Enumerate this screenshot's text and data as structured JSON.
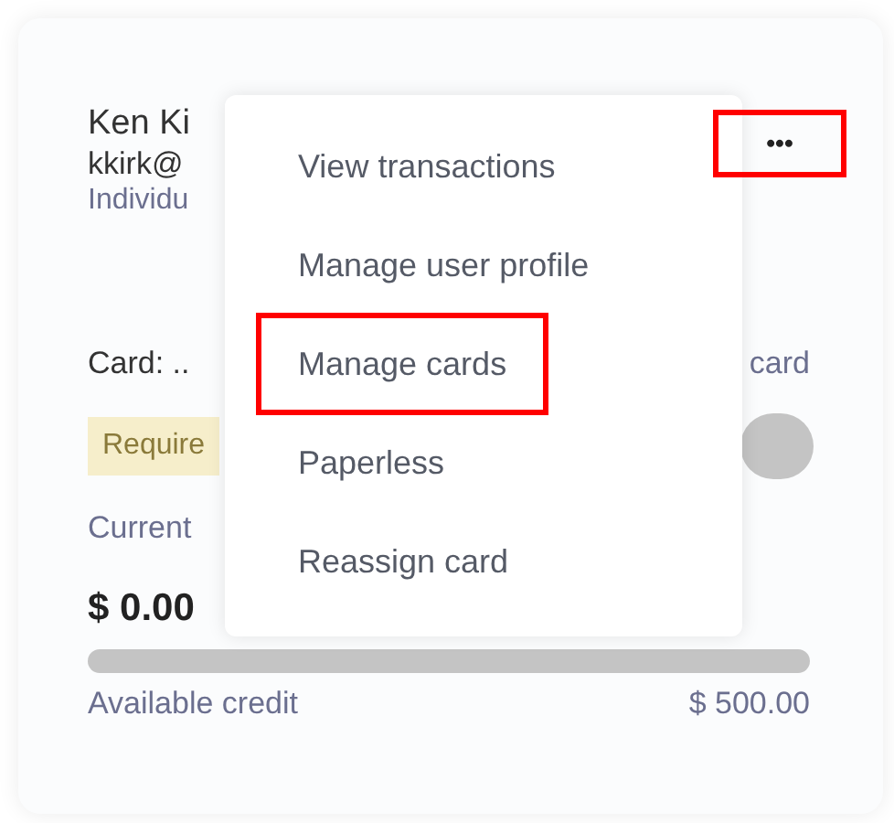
{
  "account": {
    "name": "Ken Ki",
    "email": "kkirk@",
    "type": "Individu",
    "card": "Card: ..",
    "card_link": "card",
    "badge": "Require",
    "toggle_on": false,
    "current_label": "Current",
    "balance": "$ 0.00",
    "level": 0,
    "available_label": "Available credit",
    "available_amount": "$ 500.00"
  },
  "more_button": {
    "label": "•••",
    "highlighted": true
  },
  "menu": [
    {
      "label": "View transactions",
      "highlighted": false
    },
    {
      "label": "Manage user profile",
      "highlighted": false
    },
    {
      "label": "Manage cards",
      "highlighted": true
    },
    {
      "label": "Paperless",
      "highlighted": false
    },
    {
      "label": "Reassign card",
      "highlighted": false
    }
  ]
}
